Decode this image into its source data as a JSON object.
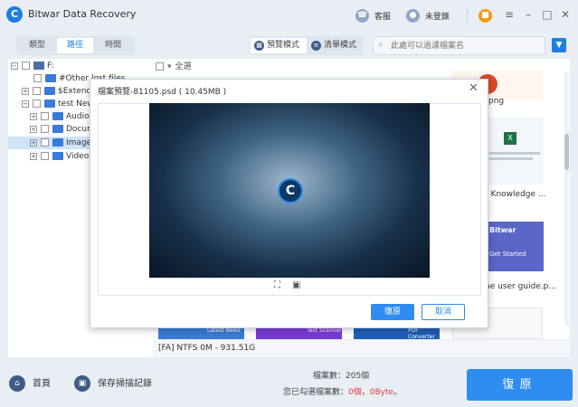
{
  "app": {
    "title": "Bitwar Data Recovery",
    "logo": "C"
  },
  "titlebar": {
    "service_label": "客服",
    "login_label": "未登錄"
  },
  "toolbar": {
    "tabs": [
      {
        "label": "類型"
      },
      {
        "label": "路徑"
      },
      {
        "label": "時間"
      }
    ],
    "modes": [
      {
        "label": "預覽模式"
      },
      {
        "label": "清單模式"
      }
    ],
    "search_placeholder": "此處可以過濾檔案名"
  },
  "tree": [
    {
      "label": "F:"
    },
    {
      "label": "#Other lost files"
    },
    {
      "label": "$Extend"
    },
    {
      "label": "test New"
    },
    {
      "label": "Audios"
    },
    {
      "label": "Docum"
    },
    {
      "label": "Images"
    },
    {
      "label": "Videos"
    }
  ],
  "grid": {
    "select_all": "全選",
    "captions": [
      "png",
      "r Knowledge ...",
      "he user guide.p..."
    ],
    "thumb_texts": {
      "bitwar": "Bitwar",
      "get_started": "Get Started",
      "latest_news": "Latest News",
      "text_scanner": "Text Scanner",
      "pdf_converter": "PDF Converter"
    }
  },
  "status_line": "[FA] NTFS 0M - 931.51G",
  "bottom": {
    "home_label": "首頁",
    "save_label": "保存掃描記錄",
    "file_count": "檔案數：205個",
    "sel_prefix": "您已勾選檔案數：",
    "sel_count": "0個",
    "sel_sep": "，",
    "sel_size": "0Byte",
    "sel_suffix": "。",
    "recover_label": "復原"
  },
  "dialog": {
    "title": "檔案預覽-81105.psd ( 10.45MB )",
    "ok_label": "復原",
    "cancel_label": "取消"
  },
  "colors": {
    "accent": "#2f8cf0",
    "danger": "#e53935",
    "bg": "#e9eef5"
  }
}
